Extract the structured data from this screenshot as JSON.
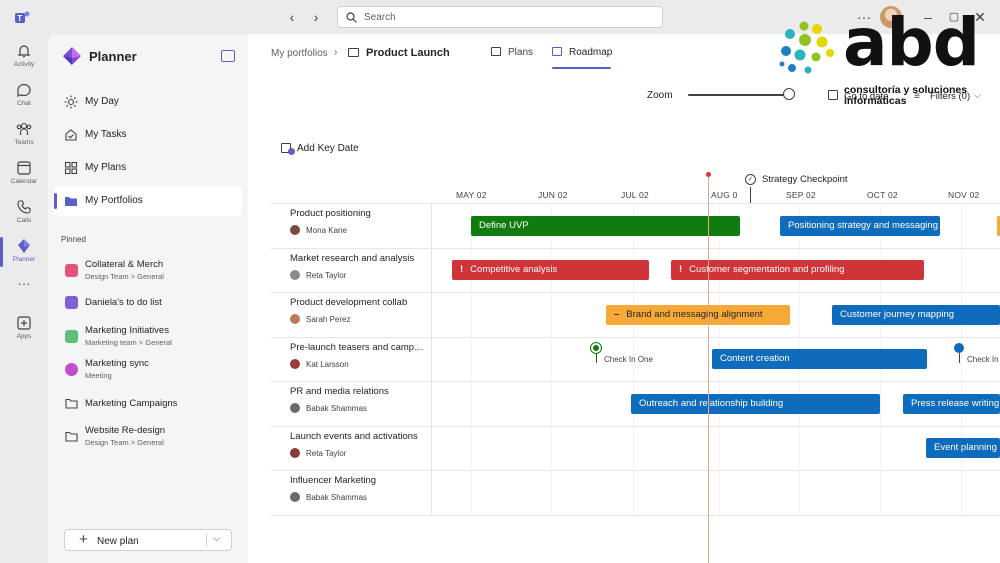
{
  "titlebar": {
    "search_placeholder": "Search"
  },
  "rail": {
    "items": [
      {
        "label": "Activity",
        "icon": "bell-icon"
      },
      {
        "label": "Chat",
        "icon": "chat-icon"
      },
      {
        "label": "Teams",
        "icon": "teams-icon"
      },
      {
        "label": "Calendar",
        "icon": "calendar-icon"
      },
      {
        "label": "Calls",
        "icon": "phone-icon"
      },
      {
        "label": "Planner",
        "icon": "planner-icon",
        "active": true
      },
      {
        "label": "",
        "icon": "more-icon"
      },
      {
        "label": "Apps",
        "icon": "apps-icon"
      }
    ]
  },
  "sidebar": {
    "title": "Planner",
    "nav": [
      {
        "label": "My Day",
        "icon": "sun-icon"
      },
      {
        "label": "My Tasks",
        "icon": "tasks-icon"
      },
      {
        "label": "My Plans",
        "icon": "grid-icon"
      },
      {
        "label": "My Portfolios",
        "icon": "folder-icon",
        "selected": true
      }
    ],
    "pinned_label": "Pinned",
    "pinned": [
      {
        "name": "Collateral & Merch",
        "sub": "Design Team > General",
        "color": "#e3537b"
      },
      {
        "name": "Daniela's to do list",
        "sub": "",
        "color": "#7b61d1"
      },
      {
        "name": "Marketing Initiatives",
        "sub": "Marketing team > General",
        "color": "#5fbf7a"
      },
      {
        "name": "Marketing sync",
        "sub": "Meeting",
        "color": "#c04fcf"
      },
      {
        "name": "Marketing Campaigns",
        "sub": "",
        "color": "#424242"
      },
      {
        "name": "Website Re-design",
        "sub": "Design Team > General",
        "color": "#424242"
      }
    ],
    "new_plan_label": "New plan"
  },
  "main": {
    "breadcrumb_root": "My portfolios",
    "breadcrumb_sep": "›",
    "breadcrumb_current": "Product Launch",
    "tabs": [
      {
        "label": "Plans"
      },
      {
        "label": "Roadmap",
        "active": true
      }
    ],
    "zoom_label": "Zoom",
    "zoom_level": 1.0,
    "goto_label": "Go to date",
    "filter_label": "Filters (0)",
    "add_key_date": "Add Key Date",
    "checkpoint_label": "Strategy Checkpoint"
  },
  "timeline": {
    "months": [
      "MAY 02",
      "JUN 02",
      "JUL 02",
      "AUG 0",
      "SEP 02",
      "OCT 02",
      "NOV 02"
    ]
  },
  "rows": [
    {
      "name": "Product positioning",
      "assignee": "Mona Kane"
    },
    {
      "name": "Market research and analysis",
      "assignee": "Reta Taylor"
    },
    {
      "name": "Product development collab",
      "assignee": "Sarah Perez"
    },
    {
      "name": "Pre-launch teasers and campaigns",
      "assignee": "Kat Larsson"
    },
    {
      "name": "PR and media relations",
      "assignee": "Babak Shammas"
    },
    {
      "name": "Launch events and activations",
      "assignee": "Reta Taylor"
    },
    {
      "name": "Influencer Marketing",
      "assignee": "Babak Shammas"
    }
  ],
  "bars": [
    {
      "label": "Define UVP",
      "color": "green",
      "warn": false
    },
    {
      "label": "Positioning strategy and messaging",
      "color": "blue",
      "warn": false
    },
    {
      "label": "Competitive analysis",
      "color": "red",
      "warn": true
    },
    {
      "label": "Customer segmentation and profiling",
      "color": "red",
      "warn": true
    },
    {
      "label": "Brand and messaging alignment",
      "color": "orange",
      "warn": true
    },
    {
      "label": "Customer journey mapping",
      "color": "blue",
      "warn": false
    },
    {
      "label": "Content creation",
      "color": "blue",
      "warn": false
    },
    {
      "label": "Outreach and relationship building",
      "color": "blue",
      "warn": false
    },
    {
      "label": "Press release writing",
      "color": "blue",
      "warn": false
    },
    {
      "label": "Event planning",
      "color": "blue",
      "warn": false
    }
  ],
  "milestones": [
    {
      "label": "Check In One"
    },
    {
      "label": "Check In"
    }
  ],
  "watermark": {
    "brand": "abd",
    "line1": "consultoría y soluciones",
    "line2": "informáticas"
  },
  "colors": {
    "accent": "#5b5fc7",
    "green": "#107c10",
    "blue": "#0f6cbd",
    "red": "#d13438",
    "orange": "#f7a938"
  }
}
